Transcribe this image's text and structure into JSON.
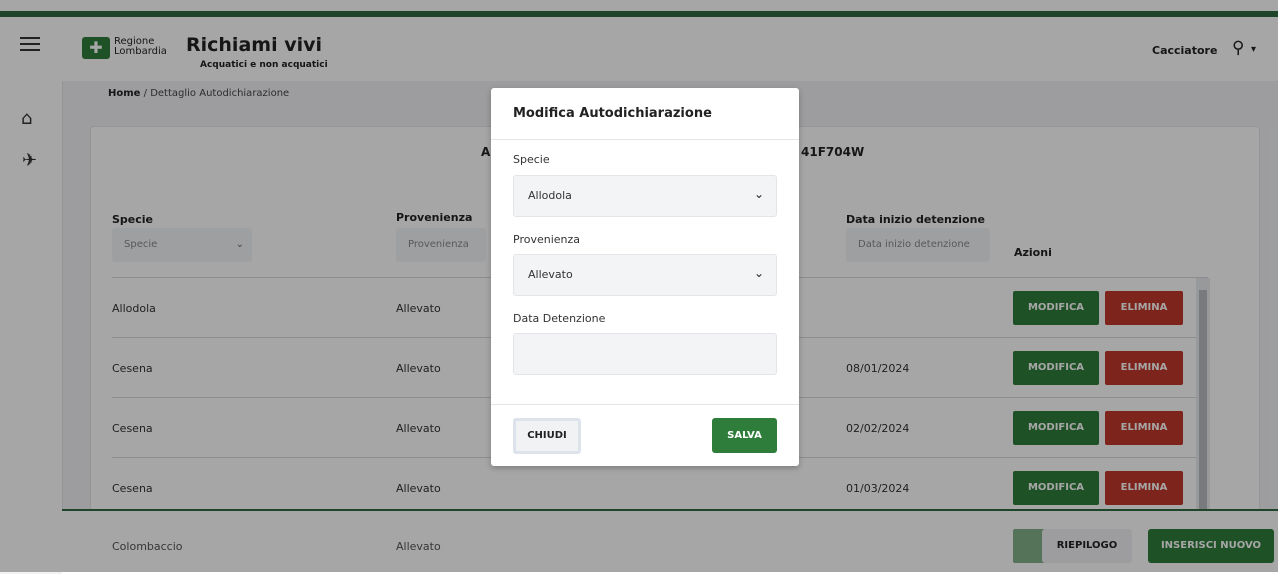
{
  "header": {
    "logo_line1": "Regione",
    "logo_line2": "Lombardia",
    "app_title": "Richiami vivi",
    "app_subtitle": "Acquatici e non acquatici",
    "user_label": "Cacciatore"
  },
  "breadcrumb": {
    "home": "Home",
    "separator": "/",
    "current": "Dettaglio Autodichiarazione"
  },
  "card": {
    "title_left": "A",
    "title_right": "41F704W"
  },
  "table": {
    "headers": {
      "specie": "Specie",
      "provenienza": "Provenienza",
      "data": "Data inizio detenzione",
      "azioni": "Azioni"
    },
    "filters": {
      "specie_placeholder": "Specie",
      "provenienza_placeholder": "Provenienza",
      "data_placeholder": "Data inizio detenzione"
    },
    "rows": [
      {
        "specie": "Allodola",
        "provenienza": "Allevato",
        "data": ""
      },
      {
        "specie": "Cesena",
        "provenienza": "Allevato",
        "data": "08/01/2024"
      },
      {
        "specie": "Cesena",
        "provenienza": "Allevato",
        "data": "02/02/2024"
      },
      {
        "specie": "Cesena",
        "provenienza": "Allevato",
        "data": "01/03/2024"
      },
      {
        "specie": "Colombaccio",
        "provenienza": "Allevato",
        "data": ""
      }
    ],
    "modifica_label": "MODIFICA",
    "elimina_label": "ELIMINA"
  },
  "footer": {
    "riepilogo": "RIEPILOGO",
    "inserisci": "INSERISCI NUOVO"
  },
  "modal": {
    "title": "Modifica Autodichiarazione",
    "specie_label": "Specie",
    "specie_value": "Allodola",
    "provenienza_label": "Provenienza",
    "provenienza_value": "Allevato",
    "data_label": "Data Detenzione",
    "data_value": "",
    "chiudi": "CHIUDI",
    "salva": "SALVA"
  },
  "colors": {
    "brand_green": "#2e7d3a",
    "danger_red": "#c0392b"
  },
  "icons": {
    "menu": "hamburger-icon",
    "home": "home-icon",
    "bird": "bird-icon",
    "user": "user-icon",
    "chevron": "chevron-down-icon"
  }
}
